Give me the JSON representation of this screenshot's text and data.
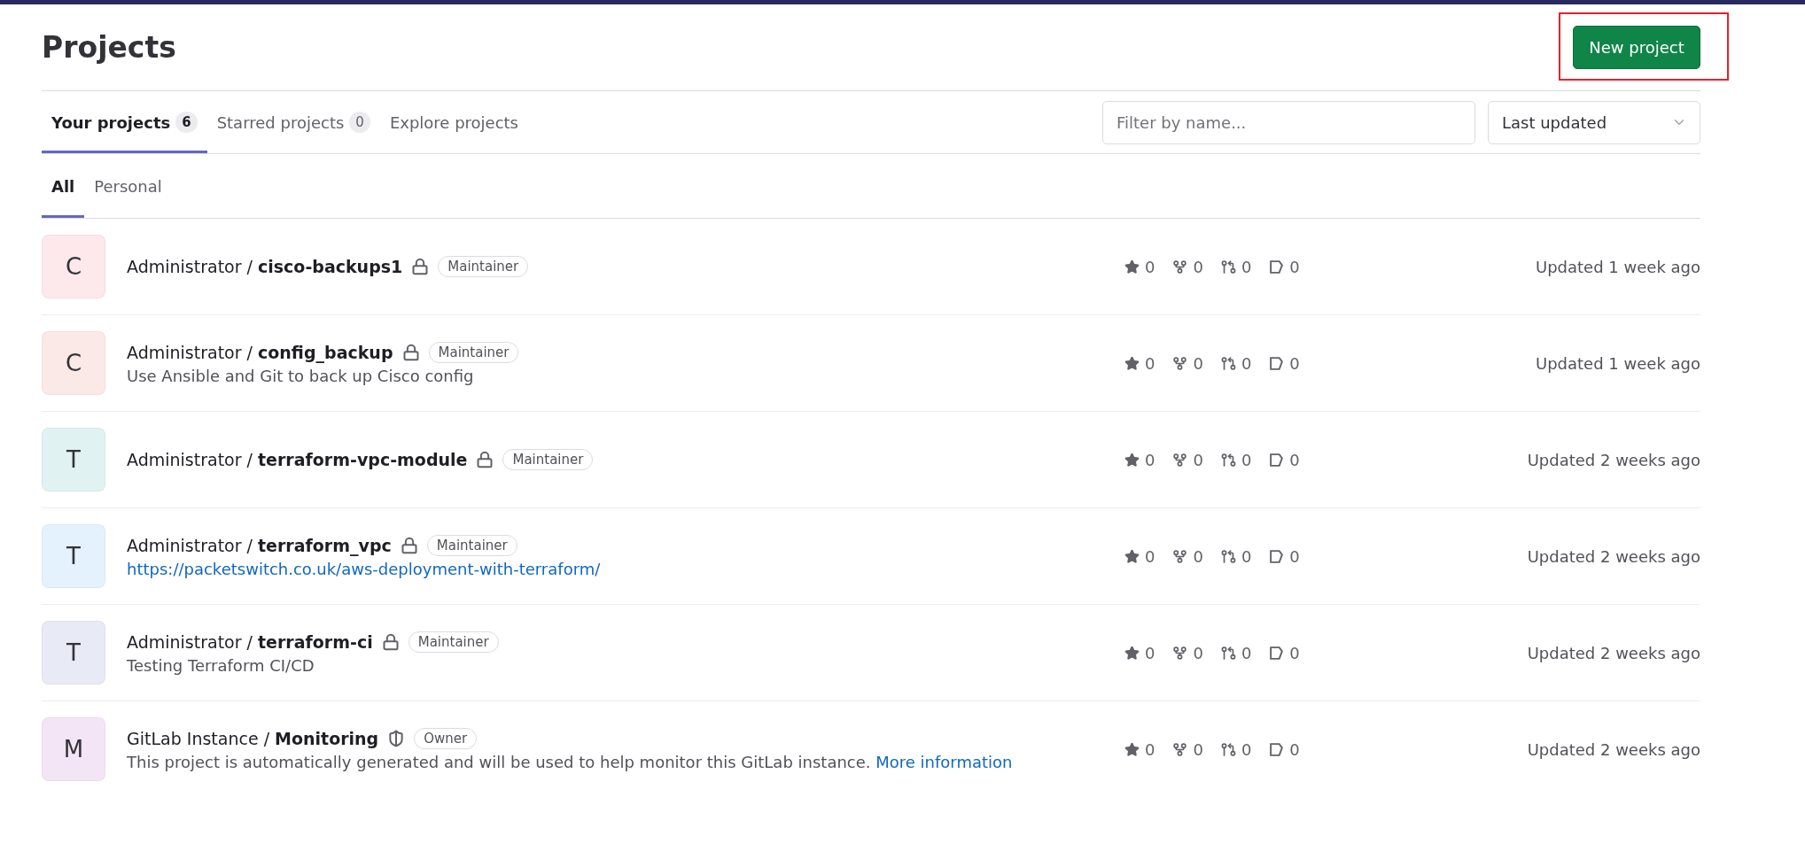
{
  "title": "Projects",
  "new_project_button": {
    "label": "New project",
    "highlighted": true
  },
  "tabs": [
    {
      "label": "Your projects",
      "count": "6",
      "selected": true
    },
    {
      "label": "Starred projects",
      "count": "0",
      "selected": false
    },
    {
      "label": "Explore projects",
      "selected": false
    }
  ],
  "filter": {
    "placeholder": "Filter by name..."
  },
  "sort": {
    "value": "Last updated"
  },
  "subtabs": [
    {
      "label": "All",
      "selected": true
    },
    {
      "label": "Personal",
      "selected": false
    }
  ],
  "projects": [
    {
      "avatar": "C",
      "color": "#fde8ec",
      "title": "Administrator / **cisco-backups1**",
      "visibility": {
        "kind": "lock"
      },
      "role": "Maintainer",
      "stars": "0",
      "forks": "0",
      "merge_requests": "0",
      "issues": "0",
      "updated": "Updated 1 week ago"
    },
    {
      "avatar": "C",
      "color": "#fbe9e7",
      "title": "Administrator / **config_backup**",
      "visibility": {
        "kind": "lock"
      },
      "role": "Maintainer",
      "description": [
        {
          "kind": "text",
          "text": "Use Ansible and Git to back up Cisco config"
        }
      ],
      "stars": "0",
      "forks": "0",
      "merge_requests": "0",
      "issues": "0",
      "updated": "Updated 1 week ago"
    },
    {
      "avatar": "T",
      "color": "#e0f2f1",
      "title": "Administrator / **terraform-vpc-module**",
      "visibility": {
        "kind": "lock"
      },
      "role": "Maintainer",
      "stars": "0",
      "forks": "0",
      "merge_requests": "0",
      "issues": "0",
      "updated": "Updated 2 weeks ago"
    },
    {
      "avatar": "T",
      "color": "#e3f2fd",
      "title": "Administrator / **terraform_vpc**",
      "visibility": {
        "kind": "lock"
      },
      "role": "Maintainer",
      "description": [
        {
          "kind": "link",
          "text": "https://packetswitch.co.uk/aws-deployment-with-terraform/"
        }
      ],
      "stars": "0",
      "forks": "0",
      "merge_requests": "0",
      "issues": "0",
      "updated": "Updated 2 weeks ago"
    },
    {
      "avatar": "T",
      "color": "#e8eaf6",
      "title": "Administrator / **terraform-ci**",
      "visibility": {
        "kind": "lock"
      },
      "role": "Maintainer",
      "description": [
        {
          "kind": "text",
          "text": "Testing Terraform CI/CD"
        }
      ],
      "stars": "0",
      "forks": "0",
      "merge_requests": "0",
      "issues": "0",
      "updated": "Updated 2 weeks ago"
    },
    {
      "avatar": "M",
      "color": "#f3e5f5",
      "title": "GitLab Instance / **Monitoring**",
      "visibility": {
        "kind": "shield"
      },
      "role": "Owner",
      "description": [
        {
          "kind": "text",
          "text": "This project is automatically generated and will be used to help monitor this GitLab instance."
        },
        {
          "kind": "link",
          "text": "More information"
        }
      ],
      "stars": "0",
      "forks": "0",
      "merge_requests": "0",
      "issues": "0",
      "updated": "Updated 2 weeks ago"
    }
  ]
}
